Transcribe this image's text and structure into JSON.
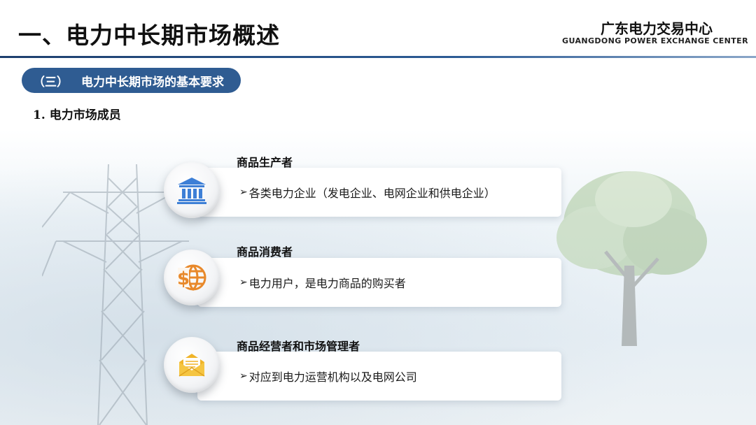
{
  "header": {
    "title": "一、电力中长期市场概述",
    "brand_cn": "广东电力交易中心",
    "brand_en": "GUANGDONG POWER EXCHANGE CENTER"
  },
  "section": {
    "number": "（三）",
    "title": "电力中长期市场的基本要求"
  },
  "subheading": {
    "number": "1.",
    "text": "电力市场成员"
  },
  "members": [
    {
      "title": "商品生产者",
      "icon": "bank-building-icon",
      "arrow": "➢",
      "desc": "各类电力企业（发电企业、电网企业和供电企业）"
    },
    {
      "title": "商品消费者",
      "icon": "dollar-globe-icon",
      "arrow": "➢",
      "desc": "电力用户，是电力商品的购买者"
    },
    {
      "title": "商品经营者和市场管理者",
      "icon": "open-envelope-icon",
      "arrow": "➢",
      "desc": "对应到电力运营机构以及电网公司"
    }
  ],
  "colors": {
    "accent": "#2f5c92",
    "icon_blue": "#3d7fd6",
    "icon_orange": "#e8892b",
    "icon_yellow": "#f5c542"
  }
}
